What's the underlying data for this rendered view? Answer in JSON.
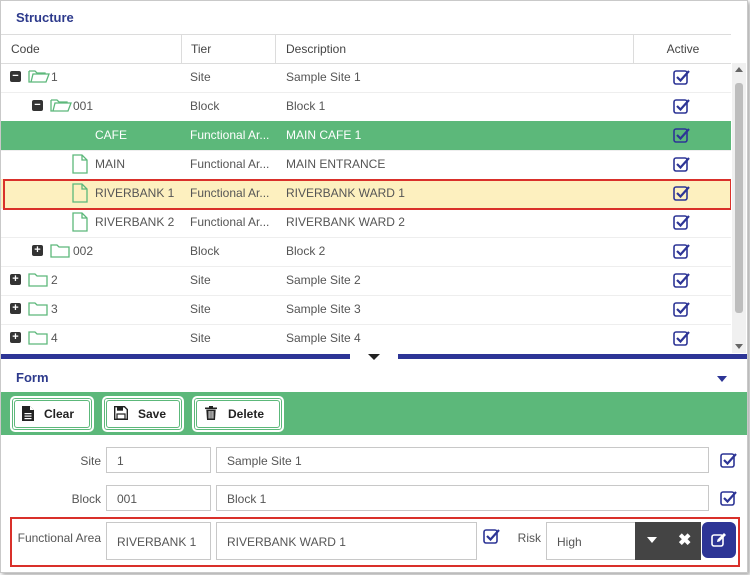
{
  "structure": {
    "title": "Structure",
    "columns": {
      "code": "Code",
      "tier": "Tier",
      "description": "Description",
      "active": "Active"
    },
    "rows": [
      {
        "code": "1",
        "tier": "Site",
        "description": "Sample Site 1",
        "toggle": "−"
      },
      {
        "code": "001",
        "tier": "Block",
        "description": "Block 1",
        "toggle": "−"
      },
      {
        "code": "CAFE",
        "tier": "Functional Ar...",
        "description": "MAIN CAFE 1"
      },
      {
        "code": "MAIN",
        "tier": "Functional Ar...",
        "description": "MAIN ENTRANCE"
      },
      {
        "code": "RIVERBANK 1",
        "tier": "Functional Ar...",
        "description": "RIVERBANK WARD 1"
      },
      {
        "code": "RIVERBANK 2",
        "tier": "Functional Ar...",
        "description": "RIVERBANK WARD 2"
      },
      {
        "code": "002",
        "tier": "Block",
        "description": "Block 2",
        "toggle": "+"
      },
      {
        "code": "2",
        "tier": "Site",
        "description": "Sample Site 2",
        "toggle": "+"
      },
      {
        "code": "3",
        "tier": "Site",
        "description": "Sample Site 3",
        "toggle": "+"
      },
      {
        "code": "4",
        "tier": "Site",
        "description": "Sample Site 4",
        "toggle": "+"
      }
    ]
  },
  "form": {
    "title": "Form",
    "toolbar": {
      "clear": "Clear",
      "save": "Save",
      "delete": "Delete"
    },
    "site": {
      "label": "Site",
      "code": "1",
      "description": "Sample Site 1"
    },
    "block": {
      "label": "Block",
      "code": "001",
      "description": "Block 1"
    },
    "functional_area": {
      "label": "Functional Area",
      "code": "RIVERBANK 1",
      "description": "RIVERBANK WARD 1"
    },
    "risk": {
      "label": "Risk",
      "value": "High"
    }
  },
  "colors": {
    "accent": "#2d3596",
    "green": "#5cb87a",
    "highlight": "#fdf0bf",
    "annotation_red": "#d9302a"
  }
}
